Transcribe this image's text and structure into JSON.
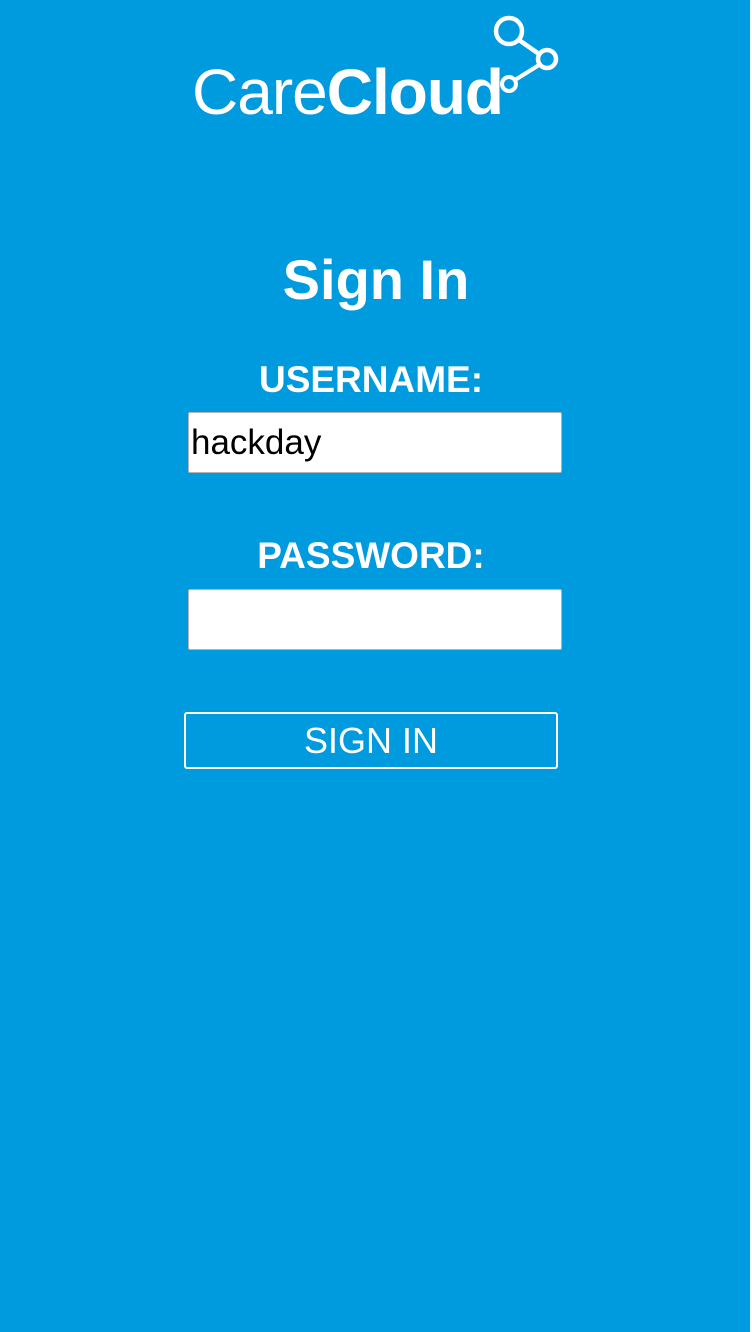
{
  "brand": {
    "name_part1": "Care",
    "name_part2": "Cloud",
    "logo_icon": "connected-nodes-icon",
    "color": "#ffffff"
  },
  "theme": {
    "background": "#009ade",
    "text": "#ffffff",
    "input_background": "#ffffff"
  },
  "form": {
    "title": "Sign In",
    "username_label": "USERNAME:",
    "username_value": "hackday",
    "password_label": "PASSWORD:",
    "password_value": "",
    "submit_label": "SIGN IN"
  }
}
